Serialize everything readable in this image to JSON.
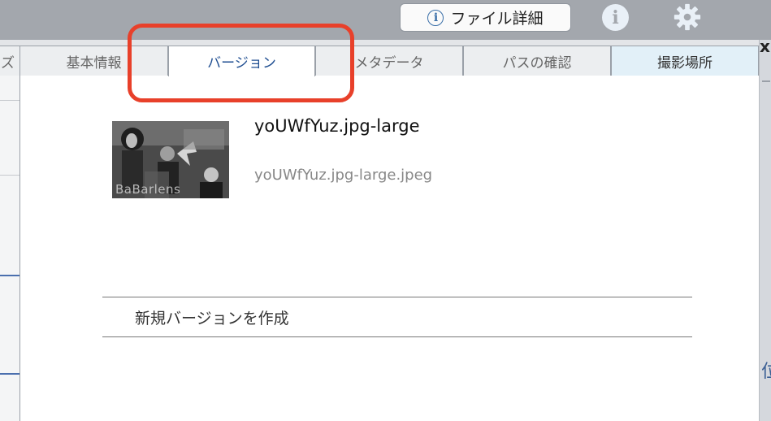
{
  "toolbar": {
    "file_details_label": "ファイル詳細",
    "info_icon": "info-icon",
    "settings_icon": "gear-icon"
  },
  "tabs": [
    {
      "label": "ズ",
      "state": "partial"
    },
    {
      "label": "基本情報",
      "state": "inactive"
    },
    {
      "label": "バージョン",
      "state": "active"
    },
    {
      "label": "メタデータ",
      "state": "inactive"
    },
    {
      "label": "パスの確認",
      "state": "inactive"
    },
    {
      "label": "撮影場所",
      "state": "highlight"
    }
  ],
  "version": {
    "title": "yoUWfYuz.jpg-large",
    "filename": "yoUWfYuz.jpg-large.jpeg",
    "thumbnail_watermark": "BaBarlens"
  },
  "actions": {
    "create_version_label": "新規バージョンを作成"
  },
  "right_strip": {
    "close_label": "x",
    "partial_text": "位"
  },
  "colors": {
    "accent": "#1f4e91",
    "annotation": "#e8402a",
    "topbar": "#a3a7ad"
  }
}
